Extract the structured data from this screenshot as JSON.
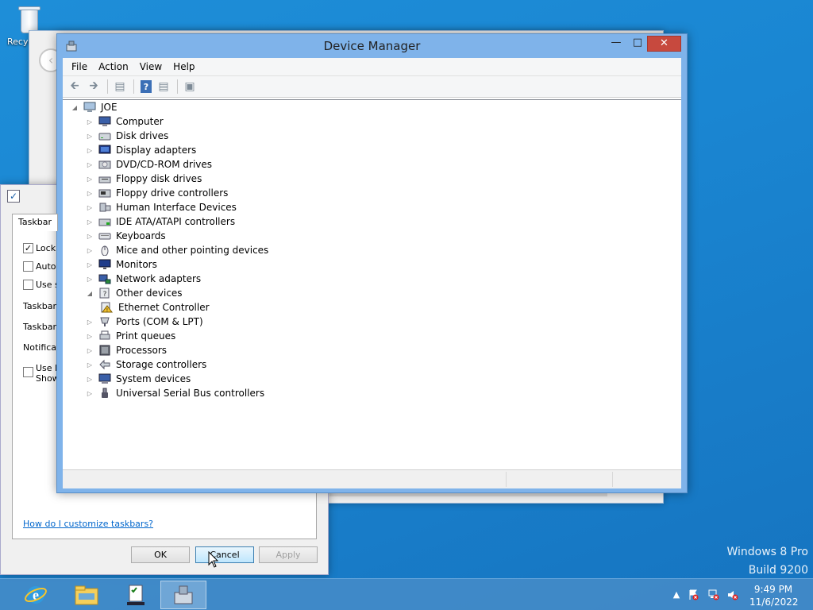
{
  "desktop": {
    "recycle_label": "Recyc",
    "watermark_line1": "Windows 8 Pro",
    "watermark_line2": "Build 9200"
  },
  "props_dialog": {
    "tab_label": "Taskbar",
    "check1": "Lock t",
    "check2": "Auto-",
    "check3": "Use s",
    "label1": "Taskbar l",
    "label2": "Taskbar l",
    "label3": "Notificati",
    "check4a": "Use P",
    "check4b": "Show",
    "link": "How do I customize taskbars?",
    "ok": "OK",
    "cancel": "Cancel",
    "apply": "Apply"
  },
  "device_manager": {
    "title": "Device Manager",
    "menu": [
      "File",
      "Action",
      "View",
      "Help"
    ],
    "root": "JOE",
    "nodes": [
      {
        "label": "Computer",
        "icon": "computer-icon",
        "expanded": false
      },
      {
        "label": "Disk drives",
        "icon": "disk-drive-icon",
        "expanded": false
      },
      {
        "label": "Display adapters",
        "icon": "display-adapter-icon",
        "expanded": false
      },
      {
        "label": "DVD/CD-ROM drives",
        "icon": "dvd-drive-icon",
        "expanded": false
      },
      {
        "label": "Floppy disk drives",
        "icon": "floppy-drive-icon",
        "expanded": false
      },
      {
        "label": "Floppy drive controllers",
        "icon": "floppy-controller-icon",
        "expanded": false
      },
      {
        "label": "Human Interface Devices",
        "icon": "hid-icon",
        "expanded": false
      },
      {
        "label": "IDE ATA/ATAPI controllers",
        "icon": "ide-controller-icon",
        "expanded": false
      },
      {
        "label": "Keyboards",
        "icon": "keyboard-icon",
        "expanded": false
      },
      {
        "label": "Mice and other pointing devices",
        "icon": "mouse-icon",
        "expanded": false
      },
      {
        "label": "Monitors",
        "icon": "monitor-icon",
        "expanded": false
      },
      {
        "label": "Network adapters",
        "icon": "network-adapter-icon",
        "expanded": false
      },
      {
        "label": "Other devices",
        "icon": "other-devices-icon",
        "expanded": true
      },
      {
        "label": "Ethernet Controller",
        "icon": "warning-device-icon",
        "child": true
      },
      {
        "label": "Ports (COM & LPT)",
        "icon": "ports-icon",
        "expanded": false
      },
      {
        "label": "Print queues",
        "icon": "printer-icon",
        "expanded": false
      },
      {
        "label": "Processors",
        "icon": "processor-icon",
        "expanded": false
      },
      {
        "label": "Storage controllers",
        "icon": "storage-controller-icon",
        "expanded": false
      },
      {
        "label": "System devices",
        "icon": "system-devices-icon",
        "expanded": false
      },
      {
        "label": "Universal Serial Bus controllers",
        "icon": "usb-icon",
        "expanded": false
      }
    ]
  },
  "taskbar": {
    "time": "9:49 PM",
    "date": "11/6/2022"
  },
  "colors": {
    "desktop": "#1a86d2",
    "window_frame": "#7fb3ea",
    "close_button": "#c7493e",
    "link": "#0066cc"
  }
}
